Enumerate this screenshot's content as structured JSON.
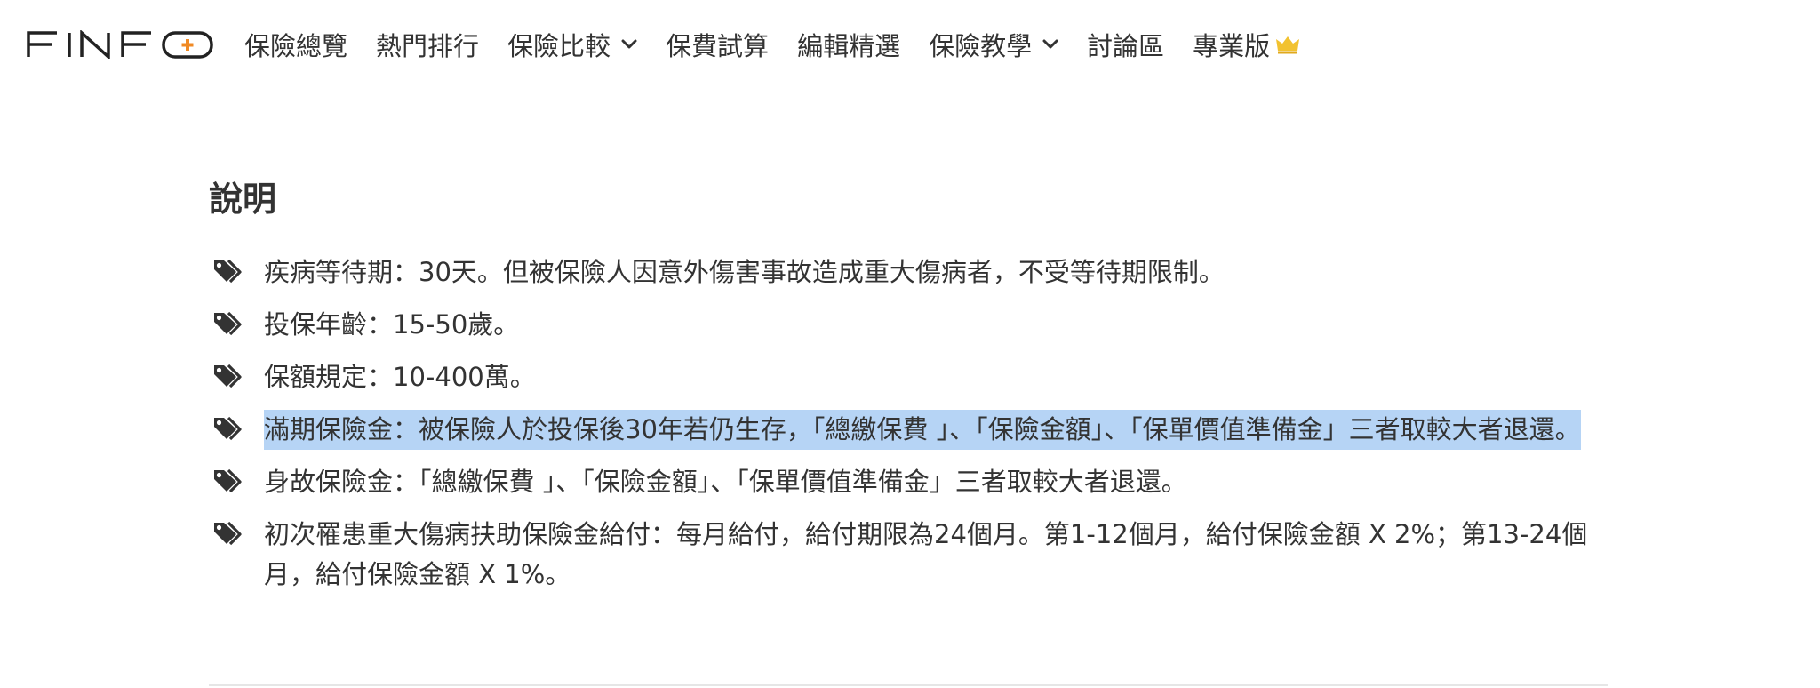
{
  "brand": {
    "logo_text": "FINFO",
    "accent_color": "#f08a24"
  },
  "nav": {
    "items": [
      {
        "label": "保險總覽",
        "has_dropdown": false
      },
      {
        "label": "熱門排行",
        "has_dropdown": false
      },
      {
        "label": "保險比較",
        "has_dropdown": true
      },
      {
        "label": "保費試算",
        "has_dropdown": false
      },
      {
        "label": "編輯精選",
        "has_dropdown": false
      },
      {
        "label": "保險教學",
        "has_dropdown": true
      },
      {
        "label": "討論區",
        "has_dropdown": false
      },
      {
        "label": "專業版",
        "has_dropdown": false,
        "icon": "crown-icon"
      }
    ]
  },
  "section": {
    "title": "說明",
    "items": [
      {
        "text": "疾病等待期：30天。但被保險人因意外傷害事故造成重大傷病者，不受等待期限制。",
        "selected": false
      },
      {
        "text": "投保年齡：15-50歲。",
        "selected": false
      },
      {
        "text": "保額規定：10-400萬。",
        "selected": false
      },
      {
        "text": "滿期保險金：被保險人於投保後30年若仍生存，「總繳保費 」、「保險金額」、「保單價值準備金」三者取較大者退還。",
        "selected": true
      },
      {
        "text": "身故保險金：「總繳保費 」、「保險金額」、「保單價值準備金」三者取較大者退還。",
        "selected": false
      },
      {
        "text": "初次罹患重大傷病扶助保險金給付：每月給付，給付期限為24個月。第1-12個月，給付保險金額 X 2%；第13-24個月，給付保險金額 X 1%。",
        "selected": false
      }
    ]
  },
  "colors": {
    "text": "#333333",
    "selection": "#b6d4f5",
    "crown": "#f2c230"
  }
}
